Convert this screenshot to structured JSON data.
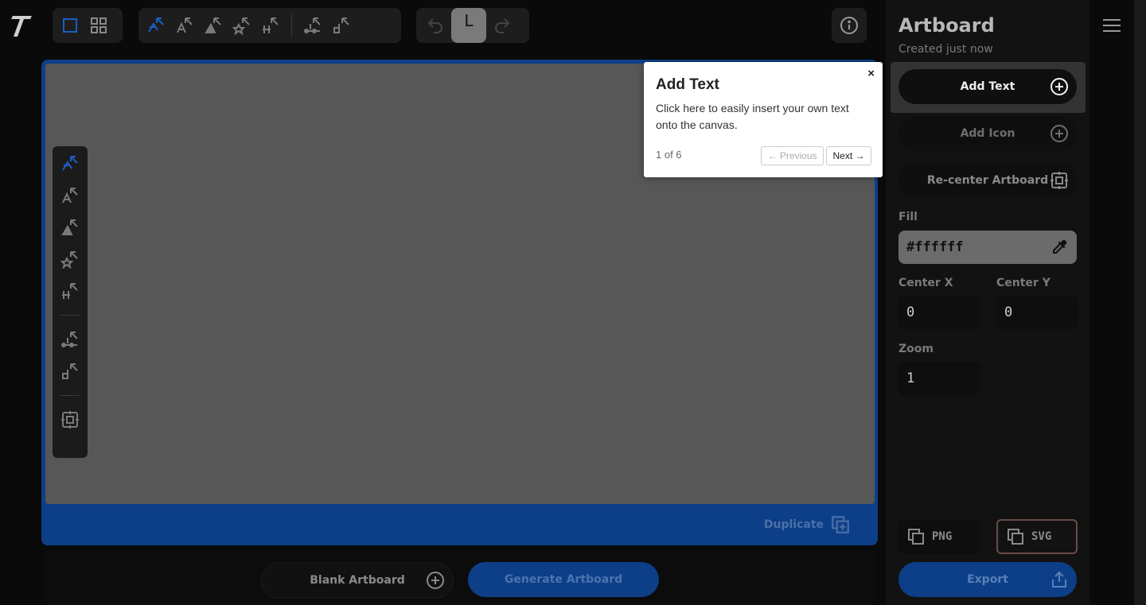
{
  "toolbar": {
    "view_modes": [
      "single-view-icon",
      "grid-view-icon"
    ],
    "layout_tools": [
      "layout-tool-1-icon",
      "layout-tool-2-icon",
      "layout-tool-3-icon",
      "layout-tool-4-icon",
      "layout-tool-5-icon",
      "layout-tool-6-icon",
      "layout-tool-7-icon"
    ],
    "preview_letter": "L"
  },
  "artboard": {
    "duplicate_label": "Duplicate",
    "blank_label": "Blank Artboard",
    "generate_label": "Generate Artboard"
  },
  "panel": {
    "title": "Artboard",
    "subtitle": "Created just now",
    "add_text_label": "Add Text",
    "add_icon_label": "Add Icon",
    "recenter_label": "Re-center Artboard",
    "fill_label": "Fill",
    "fill_value": "#ffffff",
    "center_x_label": "Center X",
    "center_x_value": "0",
    "center_y_label": "Center Y",
    "center_y_value": "0",
    "zoom_label": "Zoom",
    "zoom_value": "1",
    "png_label": "PNG",
    "svg_label": "SVG",
    "export_label": "Export"
  },
  "tour": {
    "close": "×",
    "title": "Add Text",
    "body": "Click here to easily insert your own text onto the canvas.",
    "progress": "1 of 6",
    "prev_label": "← Previous",
    "next_label": "Next →"
  },
  "colors": {
    "accent": "#1a5fc4",
    "artboard_border": "#0d3f88",
    "canvas": "#575757",
    "panel": "#121212"
  }
}
